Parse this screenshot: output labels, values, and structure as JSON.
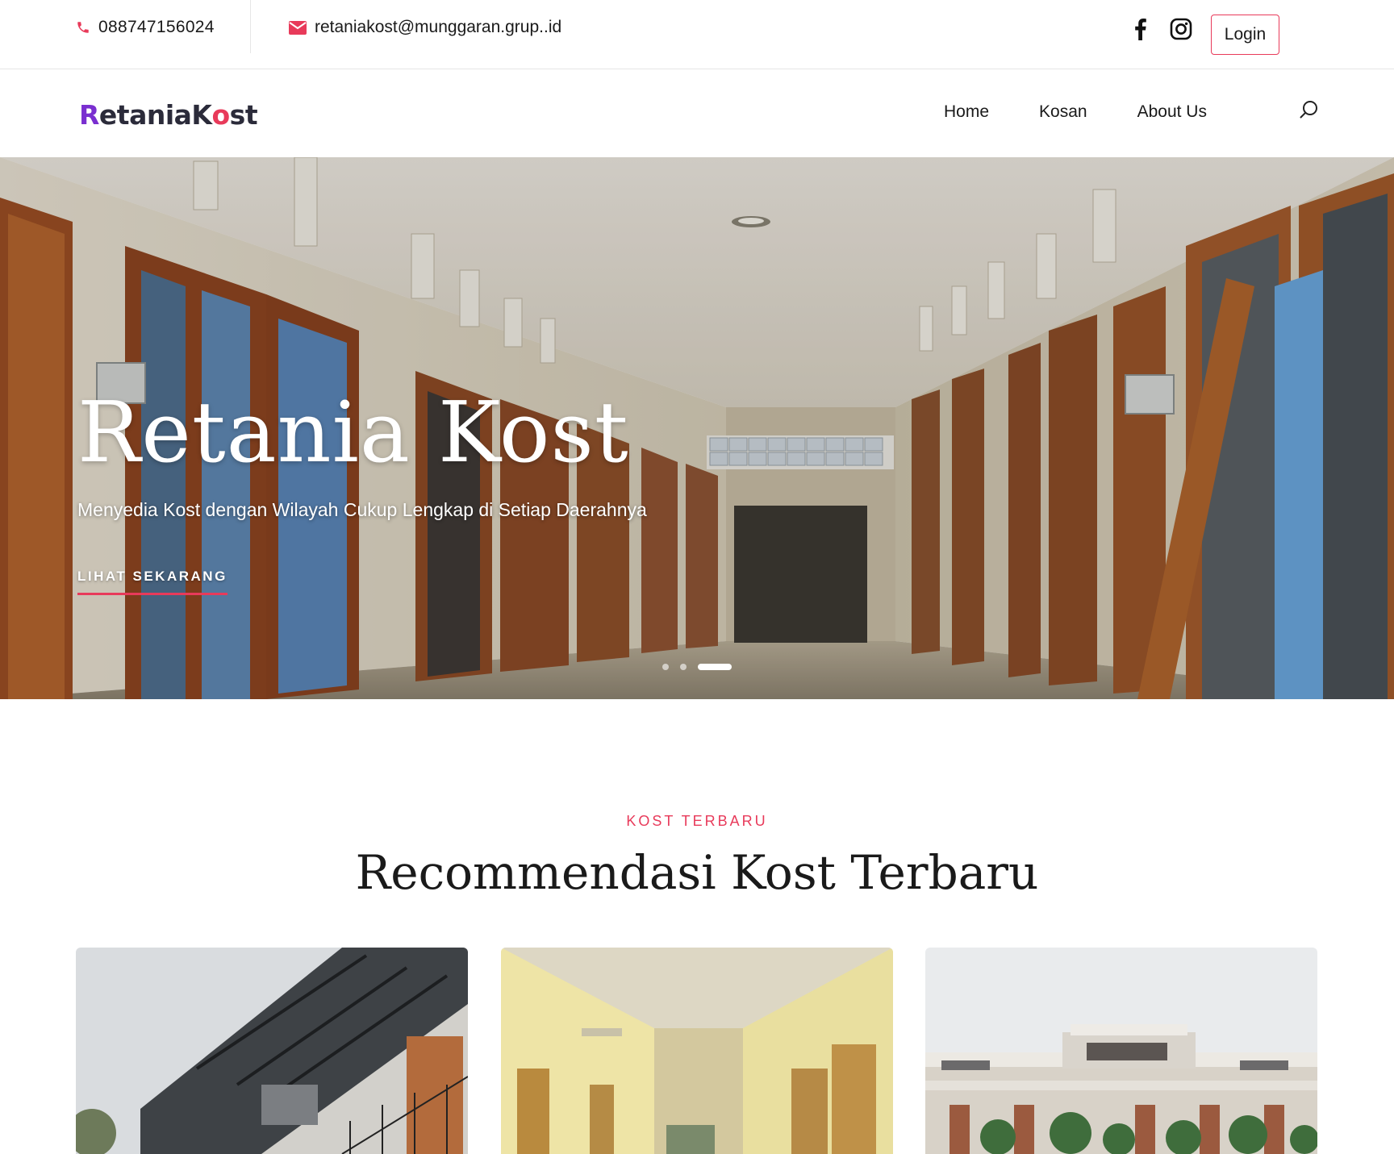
{
  "topbar": {
    "phone": "088747156024",
    "email": "retaniakost@munggaran.grup..id",
    "login_label": "Login",
    "icons": {
      "phone": "phone-icon",
      "email": "envelope-icon",
      "facebook": "facebook-icon",
      "instagram": "instagram-icon"
    }
  },
  "navbar": {
    "logo": {
      "part1": "R",
      "part2": "etaniaK",
      "part3": "o",
      "part4": "st"
    },
    "links": [
      {
        "label": "Home"
      },
      {
        "label": "Kosan"
      },
      {
        "label": "About Us"
      }
    ],
    "search_icon": "search-icon"
  },
  "hero": {
    "title": "Retania Kost",
    "subtitle": "Menyedia Kost dengan Wilayah Cukup Lengkap di Setiap Daerahnya",
    "cta_label": "LIHAT SEKARANG",
    "slides_total": 3,
    "active_slide": 3
  },
  "section": {
    "eyebrow": "KOST TERBARU",
    "title": "Recommendasi Kost Terbaru"
  },
  "colors": {
    "accent": "#e83a5a",
    "brand_purple": "#7a2fd0",
    "text": "#1a1a1a"
  }
}
